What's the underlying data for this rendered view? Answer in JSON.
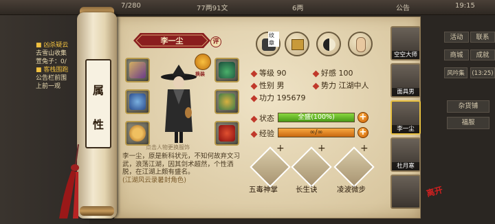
{
  "topbar": {
    "left_counter": "7/280",
    "coins": "77两91文",
    "gems": "6两",
    "announce": "公告",
    "time": "19:15"
  },
  "quests": {
    "lines": [
      "■ 凶杀疑云",
      "去雪山收集",
      "萱兔子：0/",
      "■ 客栈围跑",
      "公告栏前围",
      "上前一观"
    ]
  },
  "scroll": {
    "label_top": "属",
    "label_bottom": "性"
  },
  "character": {
    "name": "李一尘",
    "comment_badge": "评",
    "swap_label": "换装",
    "hint": "点击人物更换服饰",
    "description": "李一尘，原是新科状元，不知何故弃文习武，浪荡江湖，因其剑术超然，个性洒脱，在江湖上颇有盛名。",
    "description_note": "(江湖风云录暑封角色)"
  },
  "top_icons": [
    "纹章",
    "chest",
    "yinyang",
    "arm"
  ],
  "top_icon_badge": "纹章",
  "stats": {
    "level_label": "等级",
    "level": "90",
    "favor_label": "好感",
    "favor": "100",
    "gender_label": "性别",
    "gender": "男",
    "faction_label": "势力",
    "faction": "江湖中人",
    "power_label": "功力",
    "power": "195679",
    "status_label": "状态",
    "status_text": "全盛(100%)",
    "status_pct": 100,
    "exp_label": "经验",
    "exp_text": "∞/∞",
    "exp_pct": 100
  },
  "skills": [
    {
      "name": "五毒神掌"
    },
    {
      "name": "长生诀"
    },
    {
      "name": "凌波微步"
    }
  ],
  "companions": [
    {
      "name": "空空大师"
    },
    {
      "name": "面具男"
    },
    {
      "name": "李一尘"
    },
    {
      "name": "杜月寒"
    },
    {
      "name": ""
    }
  ],
  "right_buttons": {
    "b1": "活动",
    "b2": "联系",
    "b3": "商城",
    "b4": "成就",
    "b5": "风吟集",
    "b6": "(13:25)",
    "b7": "杂货铺",
    "b8": "福服"
  },
  "corner_badge": "离开",
  "colors": {
    "status_fill": "#6fbf2a",
    "exp_fill": "#e8861a",
    "accent": "#c0392b"
  }
}
